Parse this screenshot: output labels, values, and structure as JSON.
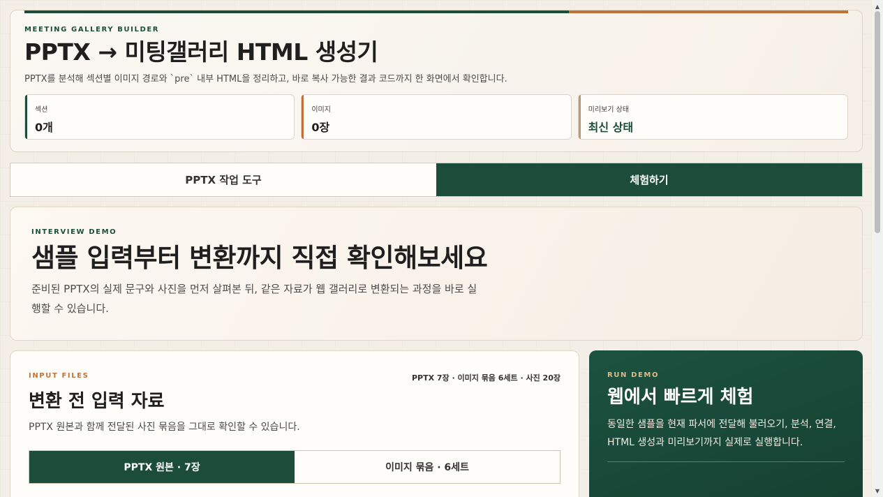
{
  "hero": {
    "eyebrow": "MEETING GALLERY BUILDER",
    "title": "PPTX → 미팅갤러리 HTML 생성기",
    "description": "PPTX를 분석해 섹션별 이미지 경로와 `pre` 내부 HTML을 정리하고, 바로 복사 가능한 결과 코드까지 한 화면에서 확인합니다.",
    "stats": [
      {
        "label": "섹션",
        "value": "0개"
      },
      {
        "label": "이미지",
        "value": "0장"
      },
      {
        "label": "미리보기 상태",
        "value": "최신 상태"
      }
    ]
  },
  "tabs": [
    {
      "label": "PPTX 작업 도구",
      "active": false
    },
    {
      "label": "체험하기",
      "active": true
    }
  ],
  "interview": {
    "eyebrow": "INTERVIEW DEMO",
    "title": "샘플 입력부터 변환까지 직접 확인해보세요",
    "description": "준비된 PPTX의 실제 문구와 사진을 먼저 살펴본 뒤, 같은 자료가 웹 갤러리로 변환되는 과정을 바로 실행할 수 있습니다."
  },
  "inputs": {
    "eyebrow": "INPUT FILES",
    "meta": "PPTX 7장 · 이미지 묶음 6세트 · 사진 20장",
    "title": "변환 전 입력 자료",
    "subtitle": "PPTX 원본과 함께 전달된 사진 묶음을 그대로 확인할 수 있습니다.",
    "subtabs": [
      {
        "label": "PPTX 원본 · 7장",
        "active": true
      },
      {
        "label": "이미지 묶음 · 6세트",
        "active": false
      }
    ]
  },
  "run": {
    "eyebrow": "RUN DEMO",
    "title": "웹에서 빠르게 체험",
    "description": "동일한 샘플을 현재 파서에 전달해 불러오기, 분석, 연결, HTML 생성과 미리보기까지 실제로 실행합니다."
  },
  "colors": {
    "primary_green": "#1b4d3a",
    "accent_orange": "#c0723a",
    "background": "#f3efe7"
  }
}
